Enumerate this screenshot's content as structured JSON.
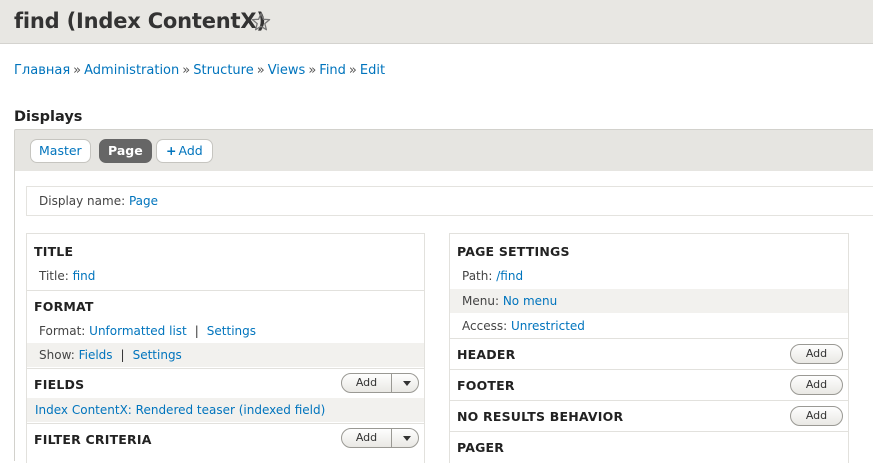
{
  "header": {
    "title": "find (Index ContentX)"
  },
  "breadcrumb": [
    "Главная",
    "Administration",
    "Structure",
    "Views",
    "Find",
    "Edit"
  ],
  "displays": {
    "heading": "Displays",
    "tabs": [
      {
        "label": "Master"
      },
      {
        "label": "Page"
      },
      {
        "label": "Add",
        "prefix": "+"
      }
    ]
  },
  "display_name": {
    "label": "Display name:",
    "value": "Page"
  },
  "left": {
    "title": {
      "heading": "TITLE",
      "label": "Title:",
      "value": "find"
    },
    "format": {
      "heading": "FORMAT",
      "format_label": "Format:",
      "format_value": "Unformatted list",
      "format_settings": "Settings",
      "show_label": "Show:",
      "show_value": "Fields",
      "show_settings": "Settings",
      "pipe": "|"
    },
    "fields": {
      "heading": "FIELDS",
      "add": "Add",
      "item": "Index ContentX: Rendered teaser (indexed field)"
    },
    "filter": {
      "heading": "FILTER CRITERIA",
      "add": "Add"
    }
  },
  "right": {
    "page_settings": {
      "heading": "PAGE SETTINGS",
      "path_label": "Path:",
      "path_value": "/find",
      "menu_label": "Menu:",
      "menu_value": "No menu",
      "access_label": "Access:",
      "access_value": "Unrestricted"
    },
    "header": {
      "heading": "HEADER",
      "add": "Add"
    },
    "footer": {
      "heading": "FOOTER",
      "add": "Add"
    },
    "no_results": {
      "heading": "NO RESULTS BEHAVIOR",
      "add": "Add"
    },
    "pager": {
      "heading": "PAGER"
    }
  }
}
